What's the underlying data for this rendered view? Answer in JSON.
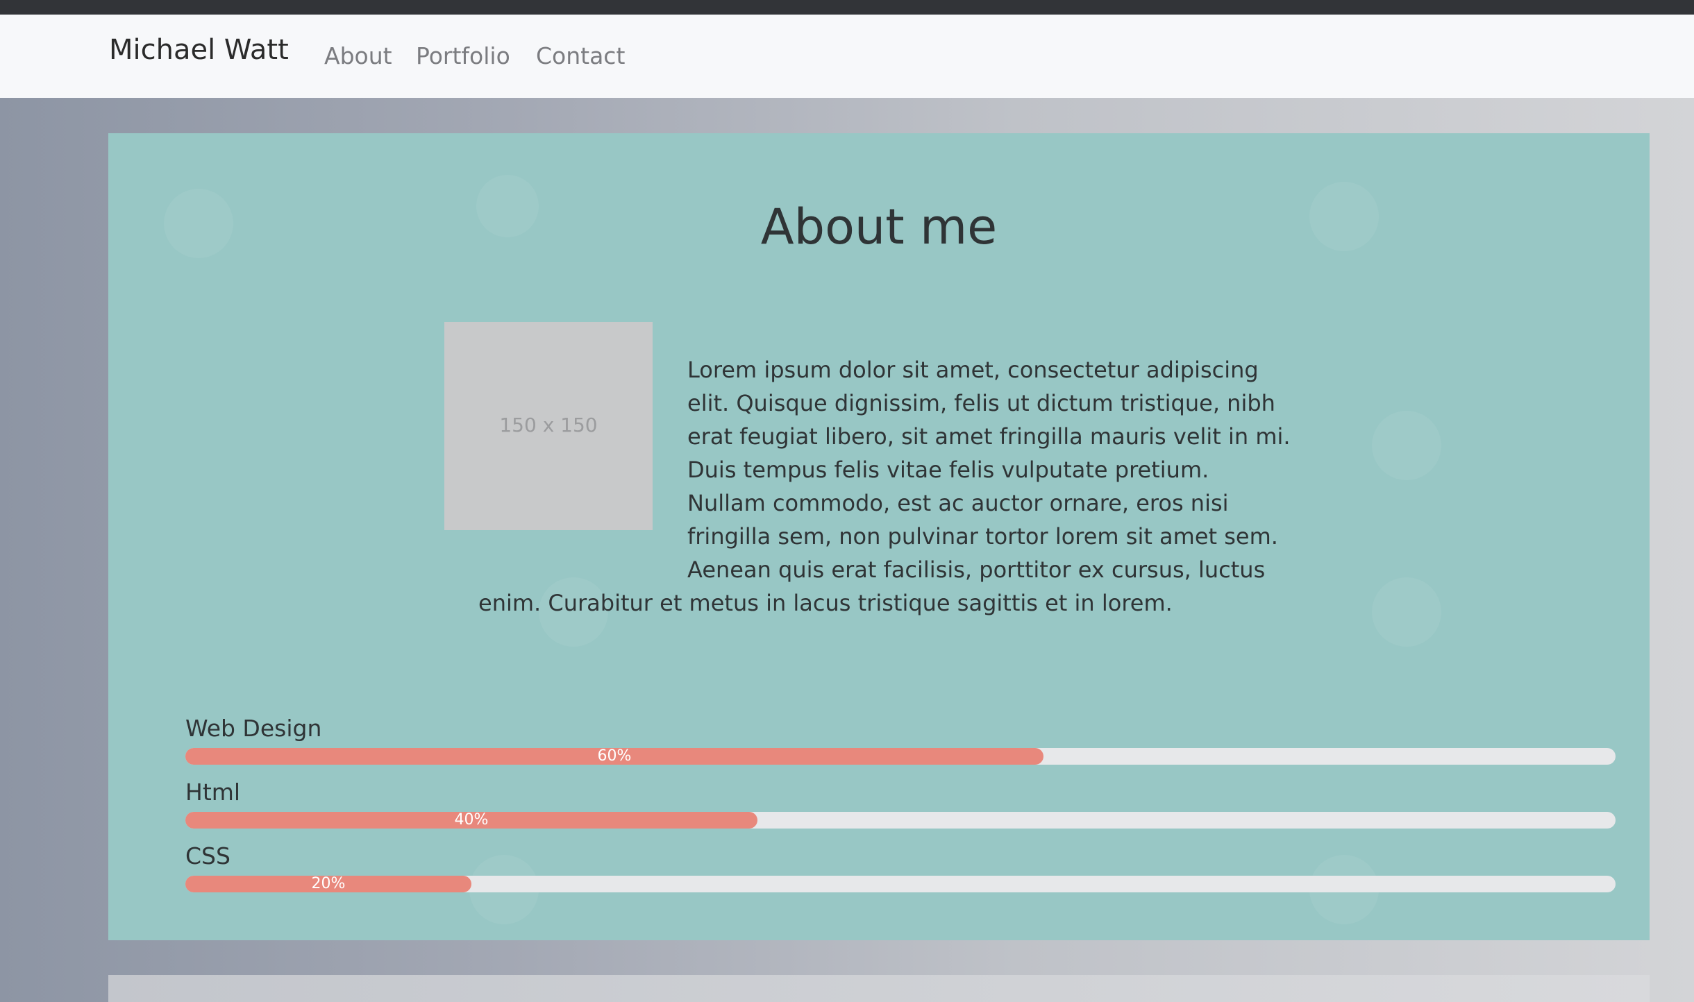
{
  "navbar": {
    "brand": "Michael Watt",
    "links": [
      "About",
      "Portfolio",
      "Contact"
    ]
  },
  "about": {
    "title": "About me",
    "image_label": "150 x 150",
    "bio_lines": [
      "Lorem ipsum dolor sit amet, consectetur adipiscing",
      "elit. Quisque dignissim, felis ut dictum tristique, nibh",
      "erat feugiat libero, sit amet fringilla mauris velit in mi.",
      "Duis tempus felis vitae felis vulputate pretium.",
      "Nullam commodo, est ac auctor ornare, eros nisi",
      "fringilla sem, non pulvinar tortor lorem sit amet sem.",
      "Aenean quis erat facilisis, porttitor ex cursus, luctus",
      "enim. Curabitur et metus in lacus tristique sagittis et in lorem."
    ]
  },
  "skills": [
    {
      "name": "Web Design",
      "percent": 60,
      "label": "60%"
    },
    {
      "name": "Html",
      "percent": 40,
      "label": "40%"
    },
    {
      "name": "CSS",
      "percent": 20,
      "label": "20%"
    }
  ],
  "colors": {
    "card_background": "#98c7c5",
    "progress_fill": "#e8887c",
    "progress_track": "#e7e8ea",
    "navbar_background": "#f7f8fa"
  }
}
